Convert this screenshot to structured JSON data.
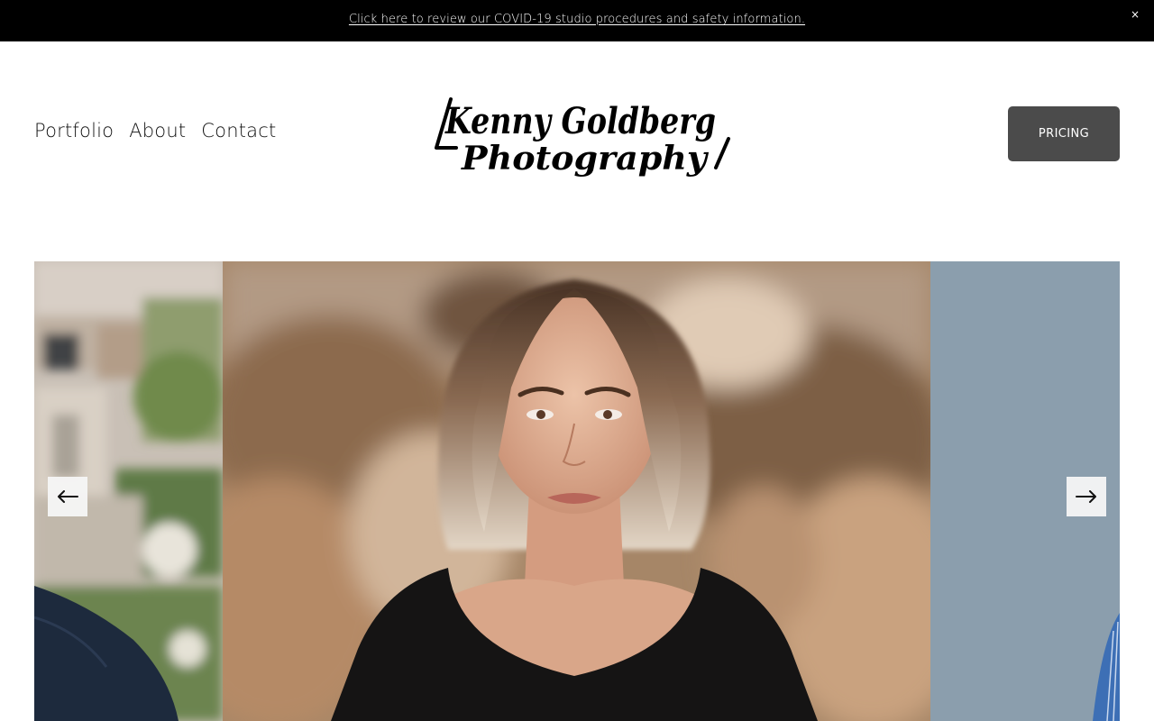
{
  "announcement": {
    "text": "Click here to review our COVID-19 studio procedures and safety information.",
    "close_glyph": "×"
  },
  "nav": {
    "items": [
      {
        "label": "Portfolio"
      },
      {
        "label": "About"
      },
      {
        "label": "Contact"
      }
    ]
  },
  "logo": {
    "line1": "Kenny Goldberg",
    "line2": "Photography"
  },
  "header": {
    "pricing_label": "PRICING"
  },
  "gallery": {
    "prev_icon": "arrow-left-icon",
    "next_icon": "arrow-right-icon"
  },
  "colors": {
    "announcement_bg": "#000000",
    "pricing_bg": "#4b4b4b",
    "page_bg": "#ffffff"
  }
}
